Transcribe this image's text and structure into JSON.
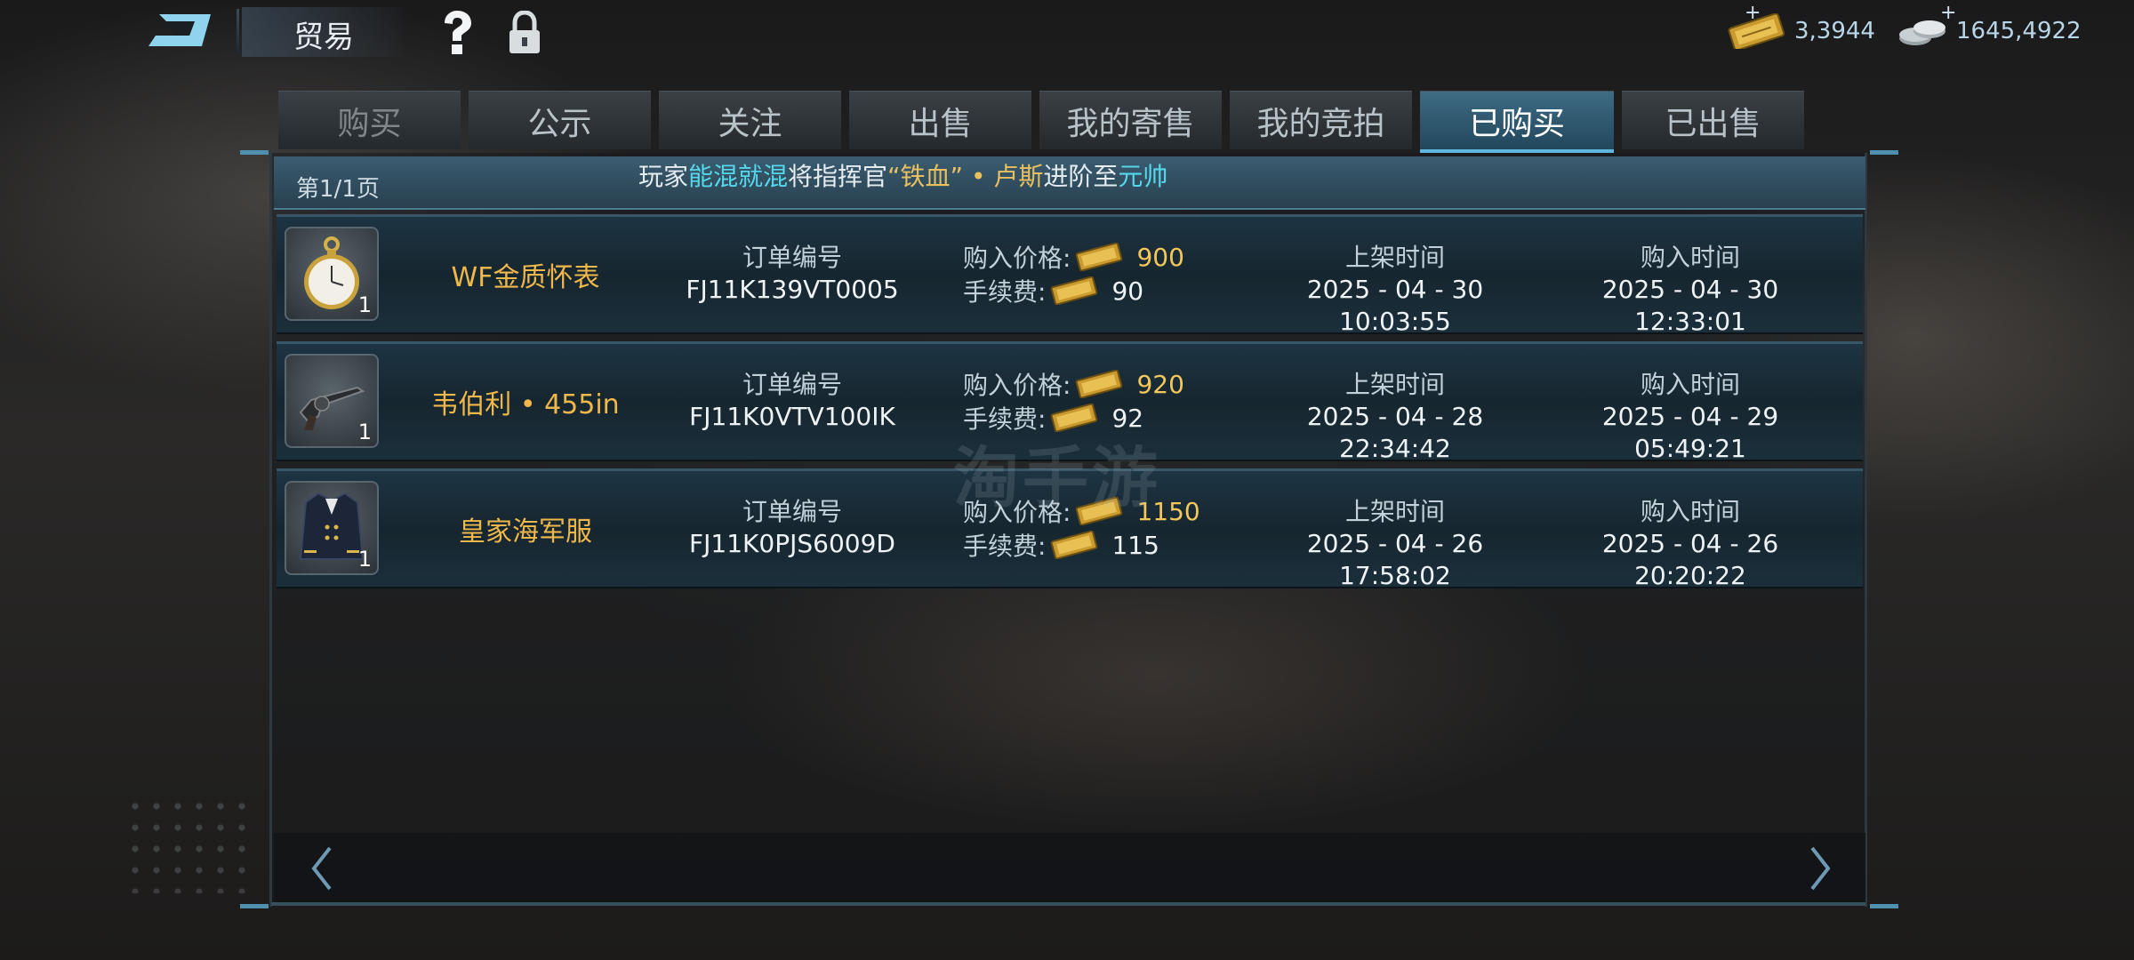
{
  "header": {
    "title": "贸易",
    "currency_gold": "3,3944",
    "currency_silver": "1645,4922",
    "plus_symbol": "+"
  },
  "tabs": [
    {
      "label": "购买"
    },
    {
      "label": "公示"
    },
    {
      "label": "关注"
    },
    {
      "label": "出售"
    },
    {
      "label": "我的寄售"
    },
    {
      "label": "我的竞拍"
    },
    {
      "label": "已购买",
      "active": true
    },
    {
      "label": "已出售"
    }
  ],
  "infobar": {
    "page": "第1/1页",
    "notice": {
      "p1": "玩家",
      "player": "能混就混",
      "p2": "将指挥官",
      "commander": "“铁血” • 卢斯",
      "p3": "进阶至",
      "rank": "元帅"
    }
  },
  "labels": {
    "order_no": "订单编号",
    "buy_price": "购入价格:",
    "fee": "手续费:",
    "listed_time": "上架时间",
    "bought_time": "购入时间"
  },
  "rows": [
    {
      "name": "WF金质怀表",
      "qty": "1",
      "order_no": "FJ11K139VT0005",
      "price": "900",
      "fee": "90",
      "listed": "2025 - 04 - 30 10:03:55",
      "bought": "2025 - 04 - 30 12:33:01",
      "icon": "pocket-watch"
    },
    {
      "name": "韦伯利 • 455in",
      "qty": "1",
      "order_no": "FJ11K0VTV100IK",
      "price": "920",
      "fee": "92",
      "listed": "2025 - 04 - 28 22:34:42",
      "bought": "2025 - 04 - 29 05:49:21",
      "icon": "revolver"
    },
    {
      "name": "皇家海军服",
      "qty": "1",
      "order_no": "FJ11K0PJS6009D",
      "price": "1150",
      "fee": "115",
      "listed": "2025 - 04 - 26 17:58:02",
      "bought": "2025 - 04 - 26 20:20:22",
      "icon": "naval-uniform"
    }
  ],
  "watermark": "淘手游",
  "colors": {
    "accent": "#5fb7e0",
    "item_name": "#f0b84a",
    "notice_highlight": "#56d8ec"
  }
}
